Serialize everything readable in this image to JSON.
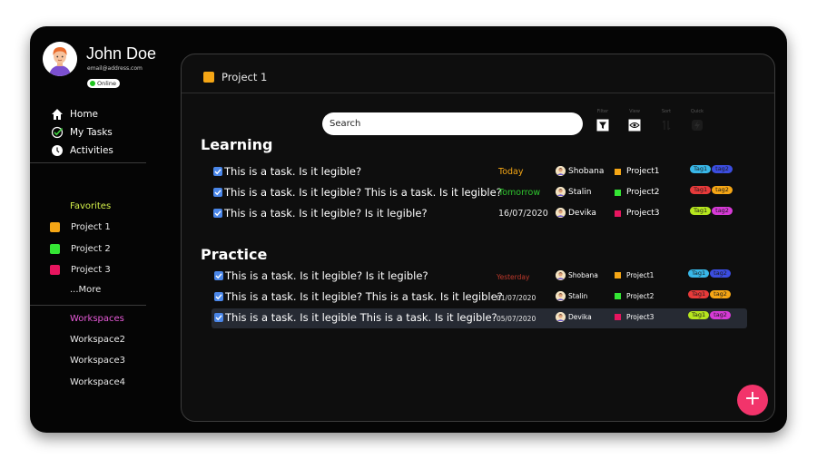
{
  "profile": {
    "name": "John Doe",
    "email": "email@address.com",
    "status": "Online"
  },
  "nav": [
    {
      "label": "Home",
      "icon": "home-icon"
    },
    {
      "label": "My Tasks",
      "icon": "check-circle-icon"
    },
    {
      "label": "Activities",
      "icon": "activity-icon"
    }
  ],
  "favorites": {
    "title": "Favorites",
    "items": [
      {
        "label": "Project 1",
        "color": "#f5a615"
      },
      {
        "label": "Project 2",
        "color": "#34e634"
      },
      {
        "label": "Project 3",
        "color": "#e8155f"
      }
    ],
    "more": "...More"
  },
  "workspaces": {
    "title": "Workspaces",
    "items": [
      "Workspace2",
      "Workspace3",
      "Workspace4"
    ]
  },
  "panel": {
    "title": "Project 1",
    "title_color": "#f5a615"
  },
  "search": {
    "placeholder": "Search"
  },
  "toolbar": {
    "filter": "Filter",
    "view": "View",
    "sort": "Sort",
    "quick": "Quick"
  },
  "groups": [
    {
      "title": "Learning",
      "rows": [
        {
          "task": "This is a task. Is it legible?",
          "date": "Today",
          "date_color": "#f5a615",
          "assignee": "Shobana",
          "project": "Project1",
          "project_color": "#f5a615",
          "tags": [
            "Tag1",
            "tag2"
          ]
        },
        {
          "task": "This is a task. Is it legible? This is a task. Is it legible?",
          "date": "Tomorrow",
          "date_color": "#2ec52e",
          "assignee": "Stalin",
          "project": "Project2",
          "project_color": "#34e634",
          "tags": [
            "Tag1",
            "tag2"
          ]
        },
        {
          "task": "This is a task. Is it legible? Is it legible?",
          "date": "16/07/2020",
          "date_color": "#e8e8e8",
          "assignee": "Devika",
          "project": "Project3",
          "project_color": "#e8155f",
          "tags": [
            "Tag1",
            "tag2"
          ]
        }
      ]
    },
    {
      "title": "Practice",
      "rows": [
        {
          "task": "This is a task. Is it legible? Is it legible?",
          "date": "Yesterday",
          "date_color": "#c0392b",
          "assignee": "Shobana",
          "project": "Project1",
          "project_color": "#f5a615",
          "tags": [
            "Tag1",
            "tag2"
          ]
        },
        {
          "task": "This is a task. Is it legible? This is a task. Is it legible?",
          "date": "01/07/2020",
          "date_color": "#e8e8e8",
          "assignee": "Stalin",
          "project": "Project2",
          "project_color": "#34e634",
          "tags": [
            "Tag1",
            "tag2"
          ]
        },
        {
          "task": "This is a task. Is it legible This is a task. Is it legible?",
          "date": "05/07/2020",
          "date_color": "#e8e8e8",
          "assignee": "Devika",
          "project": "Project3",
          "project_color": "#e8155f",
          "tags": [
            "Tag1",
            "tag2"
          ]
        }
      ]
    }
  ],
  "fab": {
    "label": "+"
  },
  "colors": {
    "favorites_title": "#d4f04a",
    "workspaces_title": "#e75ad8",
    "accent": "#f2346b"
  }
}
